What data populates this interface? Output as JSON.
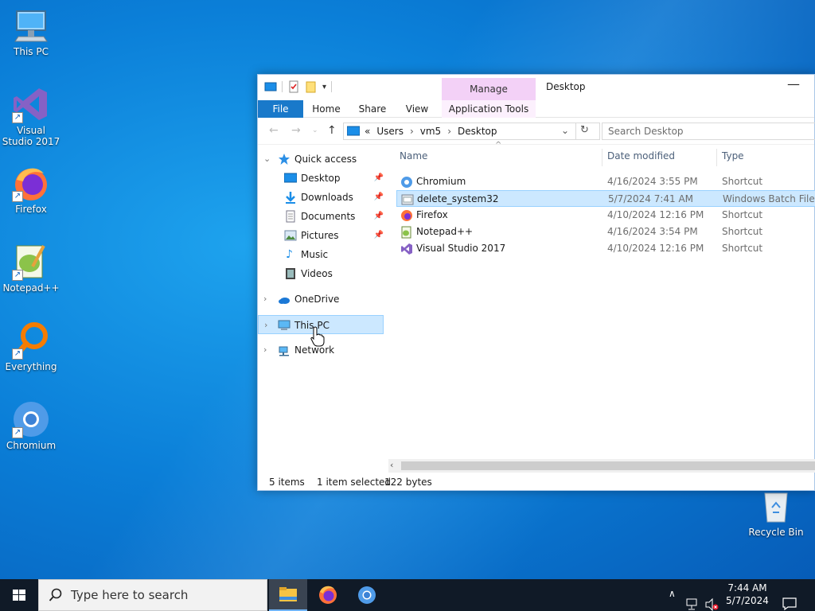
{
  "desktop": {
    "icons": [
      {
        "label": "This PC"
      },
      {
        "label": "Visual Studio 2017"
      },
      {
        "label": "Firefox"
      },
      {
        "label": "Notepad++"
      },
      {
        "label": "Everything"
      },
      {
        "label": "Chromium"
      },
      {
        "label": "Recycle Bin"
      }
    ]
  },
  "explorer": {
    "title": "Desktop",
    "contextual_tab": "Manage",
    "ribbon_tabs": {
      "file": "File",
      "home": "Home",
      "share": "Share",
      "view": "View",
      "app_tools": "Application Tools"
    },
    "address": {
      "overflow": "«",
      "parts": [
        "Users",
        "vm5",
        "Desktop"
      ]
    },
    "search_placeholder": "Search Desktop",
    "nav": {
      "quick_access": "Quick access",
      "items": [
        {
          "label": "Desktop",
          "pinned": true
        },
        {
          "label": "Downloads",
          "pinned": true
        },
        {
          "label": "Documents",
          "pinned": true
        },
        {
          "label": "Pictures",
          "pinned": true
        },
        {
          "label": "Music",
          "pinned": false
        },
        {
          "label": "Videos",
          "pinned": false
        }
      ],
      "onedrive": "OneDrive",
      "this_pc": "This PC",
      "network": "Network"
    },
    "columns": {
      "name": "Name",
      "date": "Date modified",
      "type": "Type"
    },
    "files": [
      {
        "name": "Chromium",
        "date": "4/16/2024 3:55 PM",
        "type": "Shortcut",
        "icon": "chromium-icon"
      },
      {
        "name": "delete_system32",
        "date": "5/7/2024 7:41 AM",
        "type": "Windows Batch File",
        "icon": "batch-file-icon",
        "selected": true
      },
      {
        "name": "Firefox",
        "date": "4/10/2024 12:16 PM",
        "type": "Shortcut",
        "icon": "firefox-icon"
      },
      {
        "name": "Notepad++",
        "date": "4/16/2024 3:54 PM",
        "type": "Shortcut",
        "icon": "notepadpp-icon"
      },
      {
        "name": "Visual Studio 2017",
        "date": "4/10/2024 12:16 PM",
        "type": "Shortcut",
        "icon": "visual-studio-icon"
      }
    ],
    "status": {
      "count": "5 items",
      "selected": "1 item selected",
      "size": "122 bytes"
    }
  },
  "taskbar": {
    "search_placeholder": "Type here to search",
    "time": "7:44 AM",
    "date": "5/7/2024"
  }
}
